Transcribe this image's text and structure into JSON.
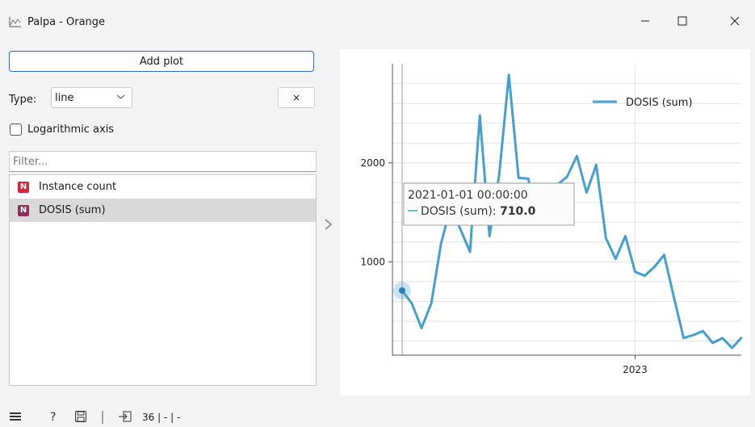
{
  "window": {
    "title": "Palpa - Orange",
    "app_icon": "line-chart-icon",
    "controls": [
      "minimize-icon",
      "maximize-icon",
      "close-icon"
    ]
  },
  "controls": {
    "add_plot_label": "Add plot",
    "type_label": "Type:",
    "type_value": "line",
    "remove_label": "×",
    "log_axis_label": "Logarithmic axis",
    "log_axis_checked": false,
    "filter_placeholder": "Filter..."
  },
  "variables": [
    {
      "badge": "N",
      "label": "Instance count",
      "color": "#d22a3c",
      "selected": false
    },
    {
      "badge": "N",
      "label": "DOSIS (sum)",
      "color": "#8e2f5a",
      "selected": true
    }
  ],
  "chart_data": {
    "type": "line",
    "xlabel": "",
    "ylabel": "",
    "x_tick_labels": [
      "2023"
    ],
    "y_tick_labels": [
      "1000",
      "2000"
    ],
    "legend": "top-right",
    "grid": true,
    "series": [
      {
        "name": "DOSIS (sum)",
        "color": "#45a0d0",
        "values": [
          710,
          580,
          330,
          580,
          1180,
          1560,
          1330,
          1100,
          2480,
          1260,
          1880,
          2890,
          1850,
          1840,
          1380,
          1640,
          1780,
          1860,
          2070,
          1700,
          1980,
          1240,
          1030,
          1260,
          900,
          860,
          950,
          1070,
          640,
          230,
          260,
          300,
          180,
          230,
          130,
          240
        ]
      }
    ],
    "hover": {
      "label": "2021-01-01 00:00:00",
      "series_label": "DOSIS (sum):",
      "value": "710.0"
    }
  },
  "status": {
    "count_text": "36 | - | -"
  }
}
